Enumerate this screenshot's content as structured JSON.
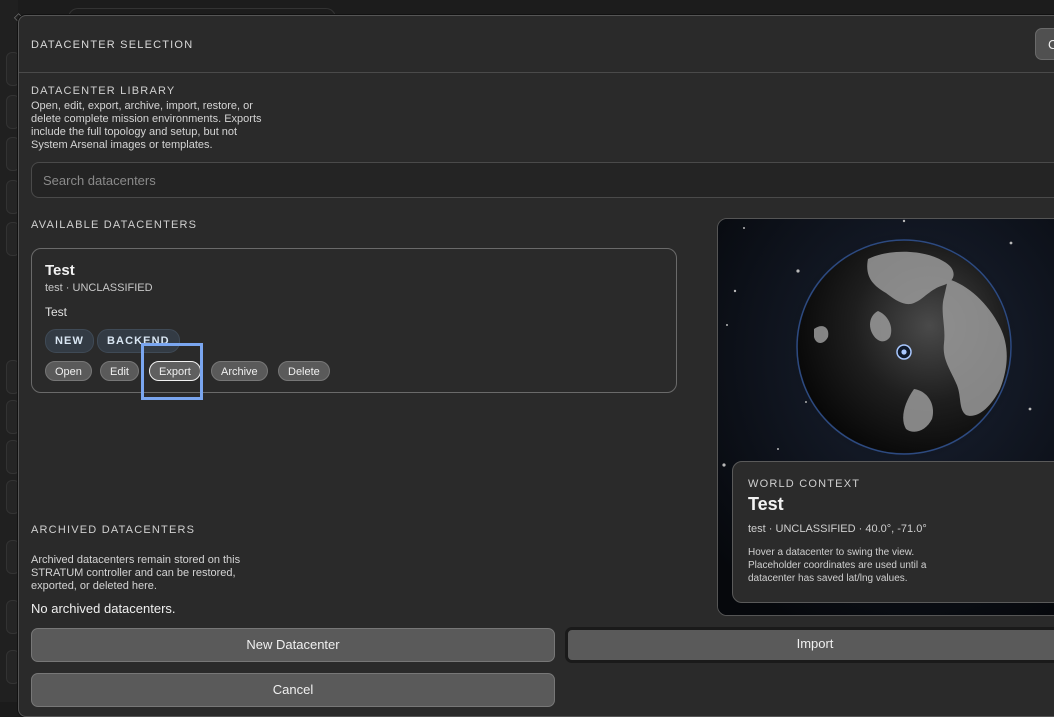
{
  "modal": {
    "title": "DATACENTER SELECTION",
    "close_label": "C"
  },
  "library": {
    "heading": "DATACENTER LIBRARY",
    "description_lines": [
      "Open, edit, export, archive, import, restore, or",
      "delete complete mission environments. Exports",
      "include the full topology and setup, but not",
      "System Arsenal images or templates."
    ]
  },
  "search": {
    "placeholder": "Search datacenters",
    "value": ""
  },
  "available": {
    "heading": "AVAILABLE DATACENTERS",
    "datacenters": [
      {
        "name": "Test",
        "meta": "test · UNCLASSIFIED",
        "description": "Test",
        "badges": [
          "NEW",
          "BACKEND"
        ],
        "actions": [
          "Open",
          "Edit",
          "Export",
          "Archive",
          "Delete"
        ]
      }
    ]
  },
  "archived": {
    "heading": "ARCHIVED DATACENTERS",
    "description_lines": [
      "Archived datacenters remain stored on this",
      "STRATUM controller and can be restored,",
      "exported, or deleted here."
    ],
    "empty_text": "No archived datacenters."
  },
  "world_context": {
    "label": "WORLD CONTEXT",
    "name": "Test",
    "meta": "test · UNCLASSIFIED · 40.0°, -71.0°",
    "description_lines": [
      "Hover a datacenter to swing the view.",
      "Placeholder coordinates are used until a",
      "datacenter has saved lat/lng values."
    ]
  },
  "footer": {
    "new_label": "New Datacenter",
    "import_label": "Import",
    "cancel_label": "Cancel"
  },
  "colors": {
    "focus_highlight": "#7aa6f0",
    "badge_bg": "#333b44",
    "marker": "#a9c8ff"
  }
}
